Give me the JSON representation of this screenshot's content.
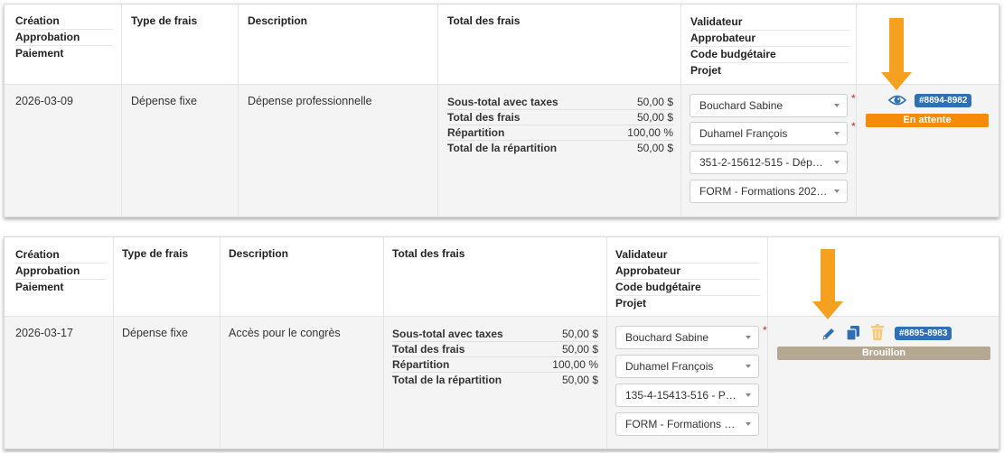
{
  "headers": {
    "col1": [
      "Création",
      "Approbation",
      "Paiement"
    ],
    "col2": "Type de frais",
    "col3": "Description",
    "col4": "Total des frais",
    "col5": [
      "Validateur",
      "Approbateur",
      "Code budgétaire",
      "Projet"
    ]
  },
  "rows": [
    {
      "date": "2026-03-09",
      "type": "Dépense fixe",
      "description": "Dépense professionnelle",
      "totals": [
        {
          "label": "Sous-total avec taxes",
          "value": "50,00 $"
        },
        {
          "label": "Total des frais",
          "value": "50,00 $"
        },
        {
          "label": "Répartition",
          "value": "100,00 %"
        },
        {
          "label": "Total de la répartition",
          "value": "50,00 $"
        }
      ],
      "selects": [
        "Bouchard Sabine",
        "Duhamel François",
        "351-2-15612-515 - Dépense ...",
        "FORM - Formations 2023-2..."
      ],
      "required_marks": [
        "*",
        "*"
      ],
      "badge": "#8894-8982",
      "status": "En attente",
      "status_color": "#f58a0b",
      "actions": [
        "eye-icon"
      ]
    },
    {
      "date": "2026-03-17",
      "type": "Dépense fixe",
      "description": "Accès pour le congrès",
      "totals": [
        {
          "label": "Sous-total avec taxes",
          "value": "50,00 $"
        },
        {
          "label": "Total des frais",
          "value": "50,00 $"
        },
        {
          "label": "Répartition",
          "value": "100,00 %"
        },
        {
          "label": "Total de la répartition",
          "value": "50,00 $"
        }
      ],
      "selects": [
        "Bouchard Sabine",
        "Duhamel François",
        "135-4-15413-516 - Pour ...",
        "FORM - Formations 202..."
      ],
      "required_marks": [
        "*"
      ],
      "badge": "#8895-8983",
      "status": "Brouillon",
      "status_color": "#b5a892",
      "actions": [
        "pencil-icon",
        "copy-icon",
        "trash-icon"
      ]
    }
  ],
  "colors": {
    "accent_arrow": "#f5a11f",
    "badge": "#2f6fb5",
    "required": "#e02020"
  }
}
